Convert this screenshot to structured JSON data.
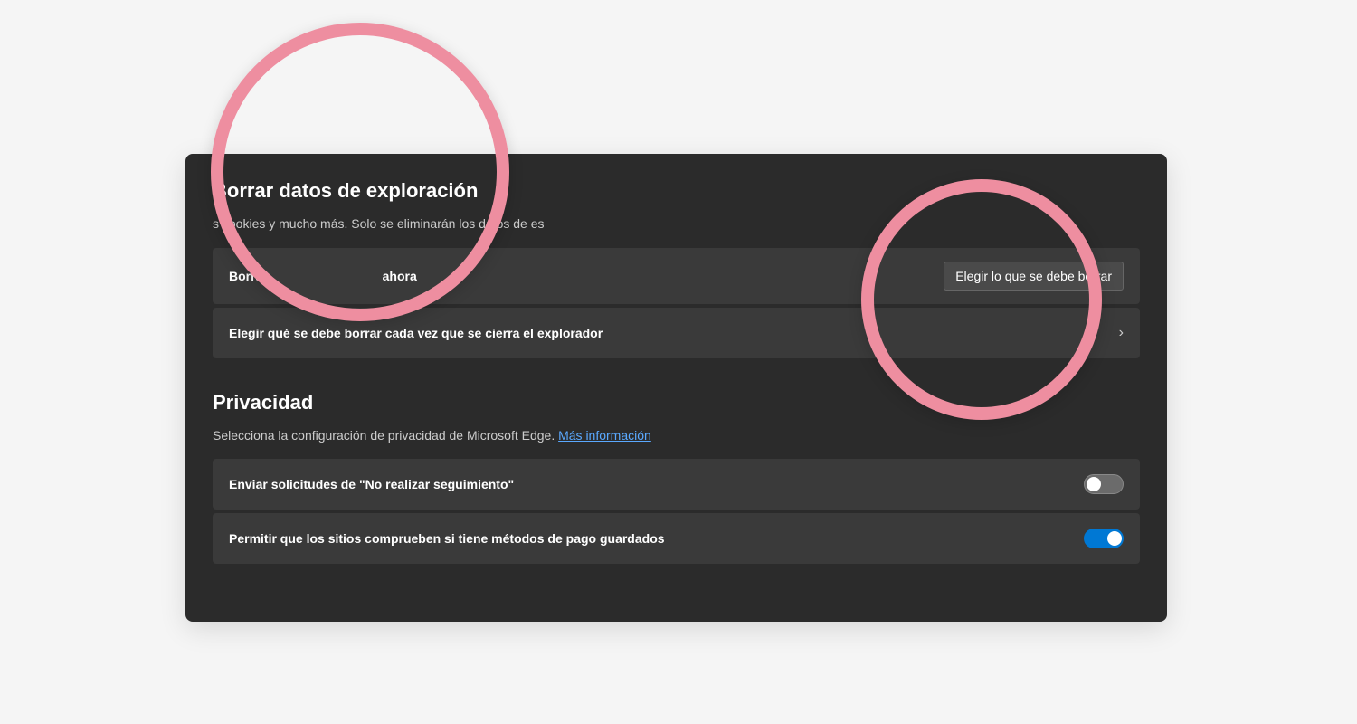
{
  "section_clear": {
    "title": "Borrar datos de exploración",
    "description_visible": "s cookies y mucho más. Solo se eliminarán los datos de es",
    "rows": [
      {
        "label_visible_left": "Borra",
        "label_visible_right": "ahora",
        "button": "Elegir lo que se debe borrar"
      },
      {
        "label": "Elegir qué se debe borrar cada vez que se cierra el explorador"
      }
    ]
  },
  "section_privacy": {
    "title": "Privacidad",
    "description": "Selecciona la configuración de privacidad de Microsoft Edge. ",
    "link_text": "Más información",
    "rows": [
      {
        "label": "Enviar solicitudes de \"No realizar seguimiento\"",
        "toggle": false
      },
      {
        "label": "Permitir que los sitios comprueben si tiene métodos de pago guardados",
        "toggle": true
      }
    ]
  }
}
